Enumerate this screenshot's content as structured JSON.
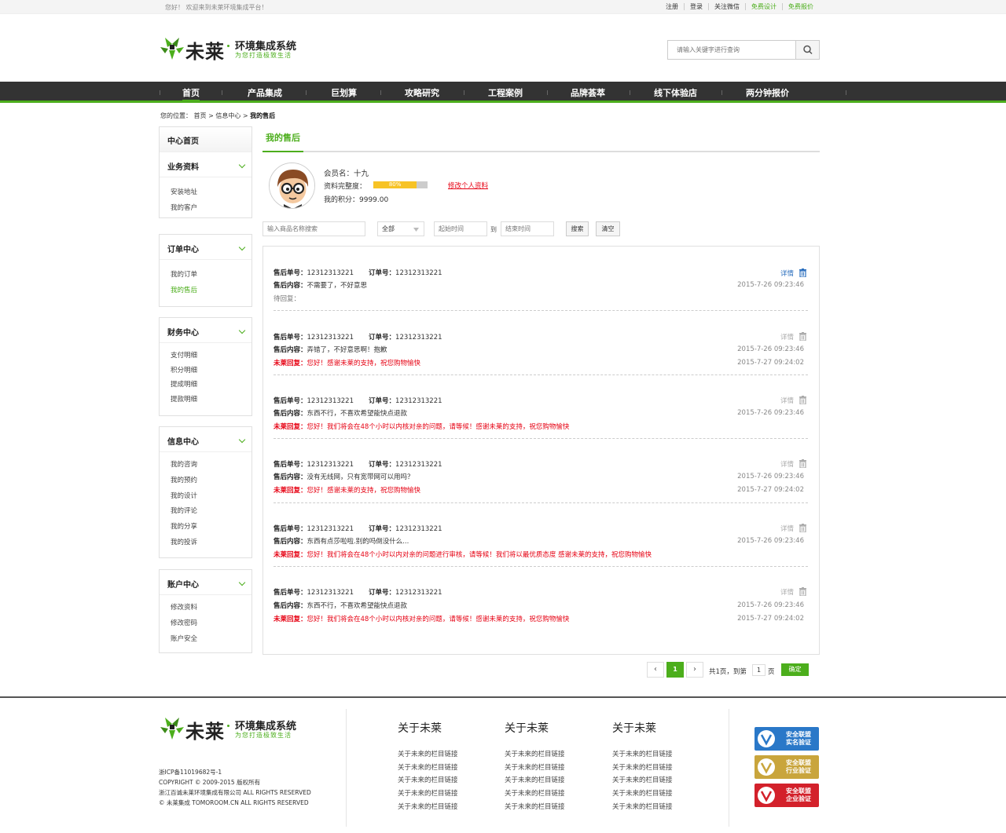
{
  "topbar": {
    "welcome": "您好！ 欢迎来到未莱环境集成平台！",
    "links": [
      "注册",
      "登录",
      "关注微信",
      "免费设计",
      "免费报价"
    ]
  },
  "header": {
    "brand_cn": "未莱",
    "brand_system": "环境集成系统",
    "slogan": "为您打造极致生活",
    "search_placeholder": "请输入关键字进行查询"
  },
  "nav": {
    "items": [
      "首页",
      "产品集成",
      "巨划算",
      "攻略研究",
      "工程案例",
      "品牌荟萃",
      "线下体验店",
      "两分钟报价"
    ],
    "active": 0
  },
  "breadcrumb": {
    "label": "您的位置：",
    "path": [
      "首页",
      "信息中心"
    ],
    "current": "我的售后"
  },
  "sidebar": {
    "home": "中心首页",
    "groups": [
      {
        "title": "业务资料",
        "links": [
          "安装地址",
          "我的客户"
        ]
      },
      {
        "title": "订单中心",
        "links": [
          "我的订单",
          "我的售后"
        ]
      },
      {
        "title": "财务中心",
        "links": [
          "支付明细",
          "积分明细",
          "提成明细",
          "提款明细"
        ]
      },
      {
        "title": "信息中心",
        "links": [
          "我的咨询",
          "我的预约",
          "我的设计",
          "我的评论",
          "我的分享",
          "我的投诉"
        ]
      },
      {
        "title": "账户中心",
        "links": [
          "修改资料",
          "修改密码",
          "账户安全"
        ]
      }
    ]
  },
  "page": {
    "title": "我的售后"
  },
  "member": {
    "name_line": "会员名：十九",
    "completeness_label": "资料完整度：",
    "completeness_pct": 80,
    "completeness_text": "80%",
    "points_line": "我的积分：9999.00",
    "edit_link": "修改个人资料"
  },
  "filter": {
    "product_placeholder": "输入商品名称搜索",
    "select_value": "全部",
    "start_placeholder": "起始时间",
    "to_label": "到",
    "end_placeholder": "结束时间",
    "search_btn": "搜索",
    "clear_btn": "清空"
  },
  "records_labels": {
    "order_label": "售后单号：",
    "ord_label": "订单号：",
    "content_label": "售后内容：",
    "reply_label": "未莱回复：",
    "detail": "详情"
  },
  "records": [
    {
      "aftersale_no": "12312313221",
      "order_no": "12312313221",
      "content": "不需要了，不好意思",
      "reply": "待回复：",
      "time1": "2015-7-26 09:23:46",
      "time2": ""
    },
    {
      "aftersale_no": "12312313221",
      "order_no": "12312313221",
      "content": "弄错了，不好意思啊！抱歉",
      "reply": "您好！感谢未莱的支持，祝您购物愉快",
      "time1": "2015-7-26 09:23:46",
      "time2": "2015-7-27 09:24:02"
    },
    {
      "aftersale_no": "12312313221",
      "order_no": "12312313221",
      "content": "东西不行，不喜欢希望能快点退款",
      "reply": "您好！我们将会在48个小时以内核对亲的问题，请等候！感谢未莱的支持，祝您购物愉快",
      "time1": "2015-7-26 09:23:46",
      "time2": ""
    },
    {
      "aftersale_no": "12312313221",
      "order_no": "12312313221",
      "content": "没有无线网，只有宽带网可以用吗？",
      "reply": "您好！感谢未莱的支持，祝您购物愉快",
      "time1": "2015-7-26 09:23:46",
      "time2": "2015-7-27 09:24:02"
    },
    {
      "aftersale_no": "12312313221",
      "order_no": "12312313221",
      "content": "东西有点莎啦啦.别的吗倒没什么...",
      "reply": "您好！我们将会在48个小时以内对亲的问题进行审核，请等候！我们将以最优质态度 感谢未莱的支持，祝您购物愉快",
      "time1": "2015-7-26 09:23:46",
      "time2": ""
    },
    {
      "aftersale_no": "12312313221",
      "order_no": "12312313221",
      "content": "东西不行，不喜欢希望能快点退款",
      "reply": "您好！我们将会在48个小时以内核对亲的问题，请等候！感谢未莱的支持，祝您购物愉快",
      "time1": "2015-7-26 09:23:46",
      "time2": "2015-7-27 09:24:02"
    }
  ],
  "pagination": {
    "prev": "‹",
    "current": "1",
    "next": "›",
    "total_text": "共1页，到第",
    "page_input": "1",
    "page_unit": "页",
    "confirm": "确定"
  },
  "footer": {
    "icp": "浙ICP备11019682号-1",
    "copyright": "COPYRIGHT © 2009-2015  版权所有",
    "company": "浙江百诚未莱环境集成有限公司  ALL RIGHTS RESERVED",
    "site": "© 未莱集成 TOMOROOM.CN ALL RIGHTS RESERVED",
    "columns": [
      {
        "title": "关于未莱",
        "links": [
          "关于未来的栏目链接",
          "关于未来的栏目链接",
          "关于未来的栏目链接",
          "关于未来的栏目链接",
          "关于未来的栏目链接"
        ]
      },
      {
        "title": "关于未莱",
        "links": [
          "关于未来的栏目链接",
          "关于未来的栏目链接",
          "关于未来的栏目链接",
          "关于未来的栏目链接",
          "关于未来的栏目链接"
        ]
      },
      {
        "title": "关于未莱",
        "links": [
          "关于未来的栏目链接",
          "关于未来的栏目链接",
          "关于未来的栏目链接",
          "关于未来的栏目链接",
          "关于未来的栏目链接"
        ]
      }
    ],
    "badges": [
      {
        "line1": "安全联盟",
        "line2": "实名验证",
        "color": "#2a78c8"
      },
      {
        "line1": "安全联盟",
        "line2": "行业验证",
        "color": "#c9a53c"
      },
      {
        "line1": "安全联盟",
        "line2": "企业验证",
        "color": "#d3212b"
      }
    ]
  },
  "colors": {
    "accent": "#4cae1c",
    "nav_bg": "#333333",
    "reply_red": "#e60012",
    "link_blue": "#2a6ebd"
  }
}
